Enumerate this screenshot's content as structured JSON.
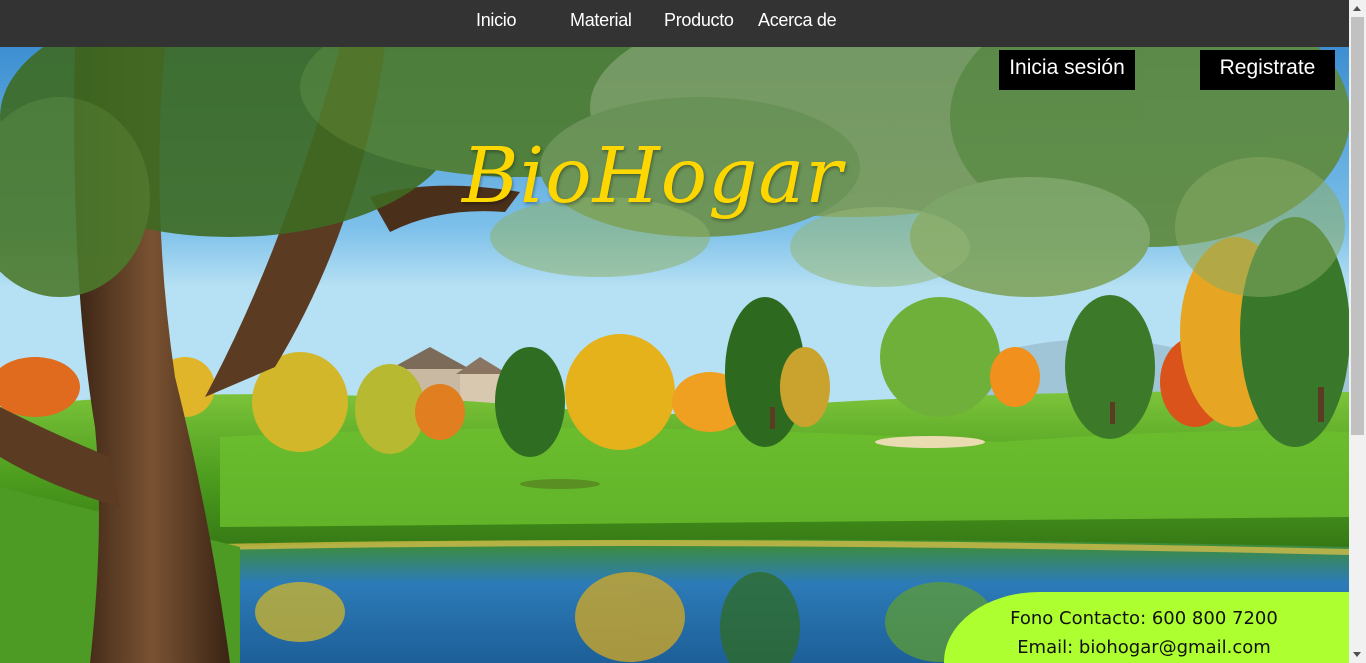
{
  "nav": {
    "items": [
      {
        "label": "Inicio"
      },
      {
        "label": "Material"
      },
      {
        "label": "Producto"
      },
      {
        "label": "Acerca de"
      }
    ]
  },
  "auth": {
    "login_label": "Inicia sesión",
    "register_label": "Registrate"
  },
  "brand": {
    "title": "BioHogar",
    "color": "#ffd700"
  },
  "contact": {
    "phone": "Fono Contacto: 600 800 7200",
    "email": "Email: biohogar@gmail.com",
    "background": "#adff2f"
  },
  "colors": {
    "navbar": "#333333",
    "button": "#000000"
  }
}
